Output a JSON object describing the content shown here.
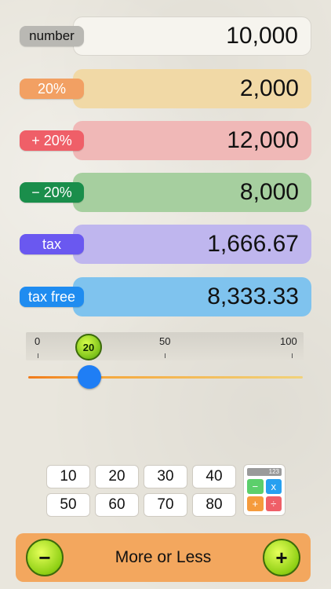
{
  "rows": [
    {
      "label": "number",
      "value": "10,000",
      "tag_color": "#b9b8b3",
      "box_color": "#f6f4ee"
    },
    {
      "label": "20%",
      "value": "2,000",
      "tag_color": "#f2a063",
      "box_color": "#f1d9a6"
    },
    {
      "label": "+ 20%",
      "value": "12,000",
      "tag_color": "#ef5f68",
      "box_color": "#f0b8b7"
    },
    {
      "label": "− 20%",
      "value": "8,000",
      "tag_color": "#1a8e4b",
      "box_color": "#a6cf9f"
    },
    {
      "label": "tax",
      "value": "1,666.67",
      "tag_color": "#6a58f0",
      "box_color": "#bfb6ee"
    },
    {
      "label": "tax free",
      "value": "8,333.33",
      "tag_color": "#1f8cf0",
      "box_color": "#7fc3ee"
    }
  ],
  "slider": {
    "scale_min": "0",
    "scale_mid": "50",
    "scale_max": "100",
    "current_label": "20",
    "value": 20
  },
  "quick_values": [
    "10",
    "20",
    "30",
    "40",
    "50",
    "60",
    "70",
    "80"
  ],
  "calculator": {
    "display": "123",
    "keys": [
      {
        "symbol": "−",
        "color": "#5ccf6b"
      },
      {
        "symbol": "x",
        "color": "#27a0f0"
      },
      {
        "symbol": "+",
        "color": "#f59b3c"
      },
      {
        "symbol": "÷",
        "color": "#ef5f68"
      }
    ]
  },
  "bottom": {
    "label": "More or Less",
    "minus": "−",
    "plus": "+"
  }
}
